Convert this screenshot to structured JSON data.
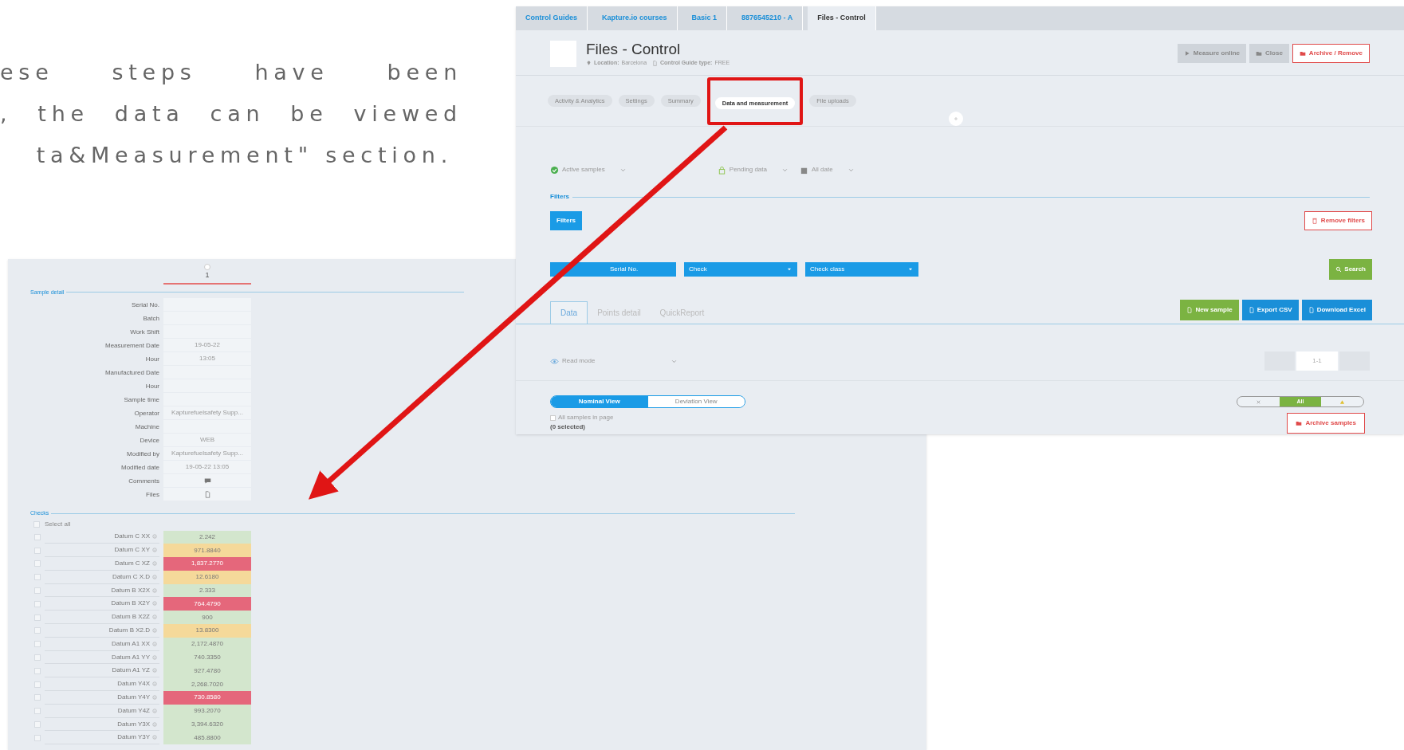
{
  "intro_text": [
    "ese steps have been",
    ", the data can be viewed",
    "ta&Measurement\" section."
  ],
  "control_window": {
    "breadcrumbs": [
      {
        "label": "Control Guides",
        "selected": false
      },
      {
        "label": "Kapture.io courses",
        "selected": false
      },
      {
        "label": "Basic 1",
        "selected": false
      },
      {
        "label": "8876545210 - A",
        "selected": false
      },
      {
        "label": "Files - Control",
        "selected": true
      }
    ],
    "title": "Files - Control",
    "location_label": "Location:",
    "location": "Barcelona",
    "type_label": "Control Guide type:",
    "type": "FREE",
    "header_buttons": [
      {
        "label": "Measure online",
        "kind": "secondary"
      },
      {
        "label": "Close",
        "kind": "secondary"
      },
      {
        "label": "Archive / Remove",
        "kind": "danger"
      }
    ],
    "section_tabs": [
      {
        "label": "Activity & Analytics",
        "selected": false
      },
      {
        "label": "Settings",
        "selected": false
      },
      {
        "label": "Summary",
        "selected": false
      },
      {
        "label": "Data and measurement",
        "selected": true
      },
      {
        "label": "File uploads",
        "selected": false
      }
    ],
    "status_filters": [
      "Active samples",
      "Pending data",
      "All date"
    ],
    "filters_section": "Filters",
    "filters_button": "Filters",
    "remove_filters_button": "Remove filters",
    "search_inputs": [
      {
        "label": "Serial No.",
        "kind": "field"
      },
      {
        "label": "Check",
        "kind": "select"
      },
      {
        "label": "Check class",
        "kind": "select"
      }
    ],
    "search_button": "Search",
    "data_tabs": [
      {
        "label": "Data",
        "selected": true
      },
      {
        "label": "Points detail",
        "selected": false
      },
      {
        "label": "QuickReport",
        "selected": false
      }
    ],
    "action_buttons": [
      {
        "label": "New sample",
        "kind": "success"
      },
      {
        "label": "Export CSV",
        "kind": "primary"
      },
      {
        "label": "Download Excel",
        "kind": "primary"
      }
    ],
    "mode_select": "Read mode",
    "pagination": "1-1",
    "view_toggle": [
      {
        "label": "Nominal View",
        "selected": true
      },
      {
        "label": "Deviation View",
        "selected": false
      }
    ],
    "result_filter": [
      {
        "kind": "fail",
        "selected": false
      },
      {
        "kind": "all",
        "label": "All",
        "selected": true
      },
      {
        "kind": "warn",
        "selected": false
      }
    ],
    "all_samples": {
      "label": "All samples in page",
      "checked": false
    },
    "selected_count": "(0 selected)",
    "archive_samples_button": "Archive samples"
  },
  "sample_window": {
    "column": {
      "label": "1",
      "selected": false
    },
    "detail_section": "Sample detail",
    "fields": [
      {
        "label": "Serial No."
      },
      {
        "label": "Batch"
      },
      {
        "label": "Work Shift"
      },
      {
        "label": "Measurement Date",
        "value": "19-05-22"
      },
      {
        "label": "Hour",
        "value": "13:05"
      },
      {
        "label": "Manufactured Date"
      },
      {
        "label": "Hour"
      },
      {
        "label": "Sample time"
      },
      {
        "label": "Operator",
        "value": "Kapturefuelsafety Supp..."
      },
      {
        "label": "Machine"
      },
      {
        "label": "Device",
        "value": "WEB"
      },
      {
        "label": "Modified by",
        "value": "Kapturefuelsafety Supp..."
      },
      {
        "label": "Modified date",
        "value": "19-05-22 13:05"
      },
      {
        "label": "Comments",
        "kind": "comment"
      },
      {
        "label": "Files",
        "kind": "file"
      }
    ],
    "checks_section": "Checks",
    "select_all": {
      "label": "Select all",
      "checked": false
    },
    "checks": [
      {
        "label": "Datum C XX",
        "value": "2.242",
        "kind": "ok",
        "checked": false
      },
      {
        "label": "Datum C XY",
        "value": "971.8840",
        "kind": "warning",
        "checked": false
      },
      {
        "label": "Datum C XZ",
        "value": "1,837.2770",
        "kind": "error",
        "checked": false
      },
      {
        "label": "Datum C X.D",
        "value": "12.6180",
        "kind": "warning",
        "checked": false
      },
      {
        "label": "Datum B X2X",
        "value": "2.333",
        "kind": "ok",
        "checked": false
      },
      {
        "label": "Datum B X2Y",
        "value": "764.4790",
        "kind": "error",
        "checked": false
      },
      {
        "label": "Datum B X2Z",
        "value": "900",
        "kind": "ok",
        "checked": false
      },
      {
        "label": "Datum B X2.D",
        "value": "13.8300",
        "kind": "warning",
        "checked": false
      },
      {
        "label": "Datum A1 XX",
        "value": "2,172.4870",
        "kind": "ok",
        "checked": false
      },
      {
        "label": "Datum A1 YY",
        "value": "740.3350",
        "kind": "ok",
        "checked": false
      },
      {
        "label": "Datum A1 YZ",
        "value": "927.4780",
        "kind": "ok",
        "checked": false
      },
      {
        "label": "Datum Y4X",
        "value": "2,268.7020",
        "kind": "ok",
        "checked": false
      },
      {
        "label": "Datum Y4Y",
        "value": "730.8580",
        "kind": "error",
        "checked": false
      },
      {
        "label": "Datum Y4Z",
        "value": "993.2070",
        "kind": "ok",
        "checked": false
      },
      {
        "label": "Datum Y3X",
        "value": "3,394.6320",
        "kind": "ok",
        "checked": false
      },
      {
        "label": "Datum Y3Y",
        "value": "485.8800",
        "kind": "ok",
        "checked": false
      }
    ]
  }
}
